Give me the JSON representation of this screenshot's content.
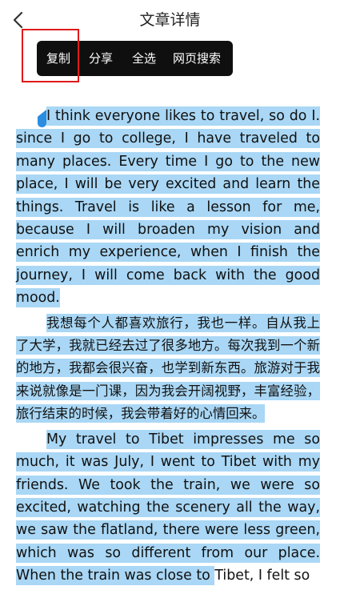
{
  "header": {
    "title": "文章详情",
    "back_icon": "chevron-left-icon"
  },
  "context_menu": {
    "items": [
      "复制",
      "分享",
      "全选",
      "网页搜索"
    ]
  },
  "article": {
    "paragraphs": [
      "I think everyone likes to travel, so do I. since I go to college, I have traveled to many places. Every time I go to the new place, I will be very excited and learn the things. Travel is like a lesson for me, because I will broaden my vision and enrich my experience, when I finish the journey, I will come back with the good mood.",
      "我想每个人都喜欢旅行，我也一样。自从我上了大学，我就已经去过了很多地方。每次我到一个新的地方，我都会很兴奋，也学到新东西。旅游对于我来说就像是一门课，因为我会开阔视野，丰富经验，旅行结束的时候，我会带着好的心情回来。",
      "My travel to Tibet impresses me so much, it was July, I went to Tibet with my friends. We took the train, we were so excited, watching the scenery all the way, we saw the flatland, there were less green, which was so different from our place. When the train was close to "
    ],
    "unselected_tail": "Tibet, I felt so"
  },
  "colors": {
    "selection": "#a9d7f5",
    "handle": "#2a8de0",
    "menu_bg": "#0f0f0f",
    "highlight": "#e01a1a"
  }
}
